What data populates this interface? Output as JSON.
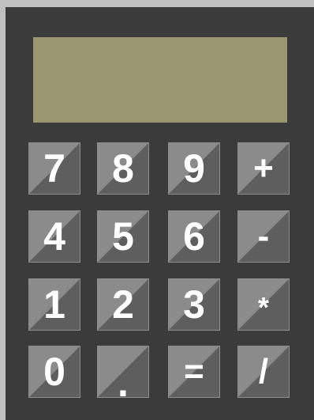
{
  "display": {
    "value": ""
  },
  "keypad": {
    "rows": [
      [
        "7",
        "8",
        "9",
        "+"
      ],
      [
        "4",
        "5",
        "6",
        "-"
      ],
      [
        "1",
        "2",
        "3",
        "*"
      ],
      [
        "0",
        ".",
        "=",
        "/"
      ]
    ]
  },
  "colors": {
    "frame": "#c0c0c0",
    "body": "#3b3b3b",
    "display": "#9a9670",
    "key_light": "#8b8b8b",
    "key_dark": "#5e5e5e",
    "key_text": "#ffffff"
  }
}
